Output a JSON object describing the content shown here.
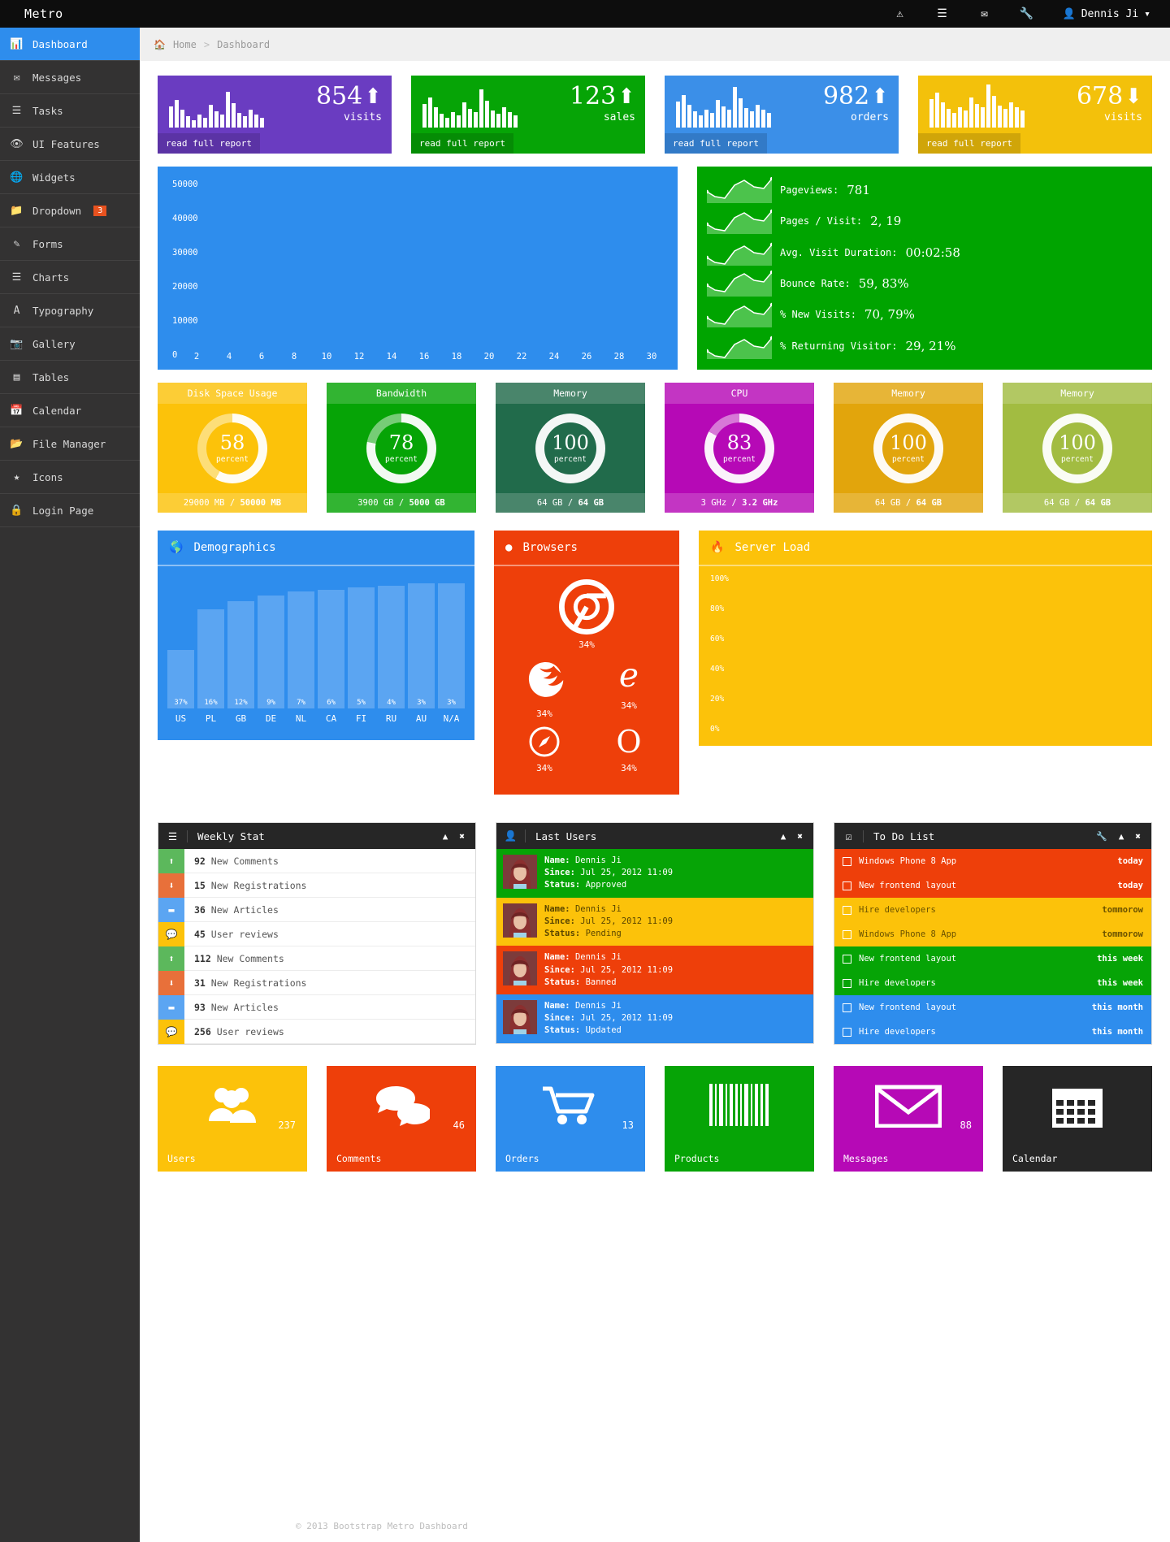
{
  "header": {
    "brand": "Metro",
    "icons": [
      "warning-icon",
      "list-icon",
      "envelope-icon",
      "wrench-icon"
    ],
    "user": "Dennis Ji"
  },
  "sidebar": {
    "items": [
      {
        "label": "Dashboard",
        "icon": "chart-icon",
        "active": true
      },
      {
        "label": "Messages",
        "icon": "envelope-icon"
      },
      {
        "label": "Tasks",
        "icon": "tasks-icon"
      },
      {
        "label": "UI Features",
        "icon": "eye-icon"
      },
      {
        "label": "Widgets",
        "icon": "globe-icon"
      },
      {
        "label": "Dropdown",
        "icon": "folder-icon",
        "badge": "3"
      },
      {
        "label": "Forms",
        "icon": "edit-icon"
      },
      {
        "label": "Charts",
        "icon": "bars-icon"
      },
      {
        "label": "Typography",
        "icon": "font-icon"
      },
      {
        "label": "Gallery",
        "icon": "image-icon"
      },
      {
        "label": "Tables",
        "icon": "table-icon"
      },
      {
        "label": "Calendar",
        "icon": "calendar-icon"
      },
      {
        "label": "File Manager",
        "icon": "folder-open-icon"
      },
      {
        "label": "Icons",
        "icon": "star-icon"
      },
      {
        "label": "Login Page",
        "icon": "lock-icon"
      }
    ]
  },
  "breadcrumb": {
    "home": "Home",
    "sep": ">",
    "current": "Dashboard"
  },
  "stat_tiles": [
    {
      "value": "854",
      "label": "visits",
      "dir": "up",
      "button": "read full report",
      "color": "#6a3cc1"
    },
    {
      "value": "123",
      "label": "sales",
      "dir": "up",
      "button": "read full report",
      "color": "#06a406"
    },
    {
      "value": "982",
      "label": "orders",
      "dir": "up",
      "button": "read full report",
      "color": "#3b8fe8"
    },
    {
      "value": "678",
      "label": "visits",
      "dir": "down",
      "button": "read full report",
      "color": "#f3c10b"
    }
  ],
  "chart_data": [
    {
      "type": "area",
      "title": "",
      "xlabel": "",
      "ylabel": "",
      "x": [
        2,
        4,
        6,
        8,
        10,
        12,
        14,
        16,
        18,
        20,
        22,
        24,
        26,
        28,
        30
      ],
      "yticks": [
        0,
        10000,
        20000,
        30000,
        40000,
        50000
      ],
      "ylim": [
        0,
        50000
      ],
      "values": [],
      "grid": false
    },
    {
      "type": "bar",
      "title": "Demographics",
      "categories": [
        "US",
        "PL",
        "GB",
        "DE",
        "NL",
        "CA",
        "FI",
        "RU",
        "AU",
        "N/A"
      ],
      "values": [
        37,
        16,
        12,
        9,
        7,
        6,
        5,
        4,
        3,
        3
      ],
      "datalabels": [
        "37%",
        "16%",
        "12%",
        "9%",
        "7%",
        "6%",
        "5%",
        "4%",
        "3%",
        "3%"
      ],
      "ylim": [
        0,
        100
      ],
      "xlabel": "",
      "ylabel": "",
      "grid": false
    },
    {
      "type": "bar",
      "title": "Server Load",
      "categories": [],
      "values": [],
      "yticks": [
        "0%",
        "20%",
        "40%",
        "60%",
        "80%",
        "100%"
      ],
      "ylim": [
        0,
        100
      ],
      "xlabel": "",
      "ylabel": "",
      "grid": false
    }
  ],
  "green_stats": [
    {
      "label": "Pageviews:",
      "value": "781"
    },
    {
      "label": "Pages / Visit:",
      "value": "2, 19"
    },
    {
      "label": "Avg. Visit Duration:",
      "value": "00:02:58"
    },
    {
      "label": "Bounce Rate:",
      "value": "59, 83%"
    },
    {
      "label": "% New Visits:",
      "value": "70, 79%"
    },
    {
      "label": "% Returning Visitor:",
      "value": "29, 21%"
    }
  ],
  "donuts": [
    {
      "title": "Disk Space Usage",
      "percent": "58",
      "unit": "percent",
      "used": "29000 MB",
      "sep": "/",
      "total": "50000 MB",
      "color": "#fcc20a",
      "arc": 58
    },
    {
      "title": "Bandwidth",
      "percent": "78",
      "unit": "percent",
      "used": "3900 GB",
      "sep": "/",
      "total": "5000 GB",
      "color": "#06a406",
      "arc": 78
    },
    {
      "title": "Memory",
      "percent": "100",
      "unit": "percent",
      "used": "64 GB",
      "sep": "/",
      "total": "64 GB",
      "color": "#216b4b",
      "arc": 100
    },
    {
      "title": "CPU",
      "percent": "83",
      "unit": "percent",
      "used": "3 GHz",
      "sep": "/",
      "total": "3.2 GHz",
      "color": "#b609b6",
      "arc": 83
    },
    {
      "title": "Memory",
      "percent": "100",
      "unit": "percent",
      "used": "64 GB",
      "sep": "/",
      "total": "64 GB",
      "color": "#e2a50c",
      "arc": 100
    },
    {
      "title": "Memory",
      "percent": "100",
      "unit": "percent",
      "used": "64 GB",
      "sep": "/",
      "total": "64 GB",
      "color": "#a2bc41",
      "arc": 100
    }
  ],
  "demographics": {
    "title": "Demographics",
    "icon": "globe-icon"
  },
  "browsers": {
    "title": "Browsers",
    "icon": "circle-icon",
    "items": [
      {
        "name": "chrome-icon",
        "pct": "34%"
      },
      {
        "name": "firefox-icon",
        "pct": "34%"
      },
      {
        "name": "ie-icon",
        "pct": "34%"
      },
      {
        "name": "safari-icon",
        "pct": "34%"
      },
      {
        "name": "opera-icon",
        "pct": "34%"
      }
    ]
  },
  "server_load": {
    "title": "Server Load",
    "icon": "fire-icon",
    "yticks": [
      "100%",
      "80%",
      "60%",
      "40%",
      "20%",
      "0%"
    ]
  },
  "weekly_stat": {
    "title": "Weekly Stat",
    "icon": "list-icon",
    "actions": [
      "collapse-icon",
      "close-icon"
    ],
    "rows": [
      {
        "icon": "arrow-up-icon",
        "color": "#5cb85c",
        "num": "92",
        "text": "New Comments"
      },
      {
        "icon": "arrow-down-icon",
        "color": "#e8703a",
        "num": "15",
        "text": "New Registrations"
      },
      {
        "icon": "minus-icon",
        "color": "#5ba5f2",
        "num": "36",
        "text": "New Articles"
      },
      {
        "icon": "comment-icon",
        "color": "#fcc20a",
        "num": "45",
        "text": "User reviews"
      },
      {
        "icon": "arrow-up-icon",
        "color": "#5cb85c",
        "num": "112",
        "text": "New Comments"
      },
      {
        "icon": "arrow-down-icon",
        "color": "#e8703a",
        "num": "31",
        "text": "New Registrations"
      },
      {
        "icon": "minus-icon",
        "color": "#5ba5f2",
        "num": "93",
        "text": "New Articles"
      },
      {
        "icon": "comment-icon",
        "color": "#fcc20a",
        "num": "256",
        "text": "User reviews"
      }
    ]
  },
  "last_users": {
    "title": "Last Users",
    "icon": "user-icon",
    "actions": [
      "collapse-icon",
      "close-icon"
    ],
    "labels": {
      "name": "Name:",
      "since": "Since:",
      "status": "Status:"
    },
    "rows": [
      {
        "name": "Dennis Ji",
        "since": "Jul 25, 2012 11:09",
        "status": "Approved",
        "color": "#06a406"
      },
      {
        "name": "Dennis Ji",
        "since": "Jul 25, 2012 11:09",
        "status": "Pending",
        "color": "#fcc20a"
      },
      {
        "name": "Dennis Ji",
        "since": "Jul 25, 2012 11:09",
        "status": "Banned",
        "color": "#ee3f0a"
      },
      {
        "name": "Dennis Ji",
        "since": "Jul 25, 2012 11:09",
        "status": "Updated",
        "color": "#2e8ded"
      }
    ]
  },
  "todo_list": {
    "title": "To Do List",
    "icon": "check-square-icon",
    "actions": [
      "wrench-icon",
      "collapse-icon",
      "close-icon"
    ],
    "rows": [
      {
        "text": "Windows Phone 8 App",
        "when": "today",
        "color": "#ee3f0a"
      },
      {
        "text": "New frontend layout",
        "when": "today",
        "color": "#ee3f0a"
      },
      {
        "text": "Hire developers",
        "when": "tommorow",
        "color": "#fcc20a"
      },
      {
        "text": "Windows Phone 8 App",
        "when": "tommorow",
        "color": "#fcc20a"
      },
      {
        "text": "New frontend layout",
        "when": "this week",
        "color": "#06a406"
      },
      {
        "text": "Hire developers",
        "when": "this week",
        "color": "#06a406"
      },
      {
        "text": "New frontend layout",
        "when": "this month",
        "color": "#2e8ded"
      },
      {
        "text": "Hire developers",
        "when": "this month",
        "color": "#2e8ded"
      }
    ]
  },
  "bottom_tiles": [
    {
      "label": "Users",
      "count": "237",
      "icon": "users-icon",
      "color": "#fcc20a"
    },
    {
      "label": "Comments",
      "count": "46",
      "icon": "comments-icon",
      "color": "#ee3f0a"
    },
    {
      "label": "Orders",
      "count": "13",
      "icon": "cart-icon",
      "color": "#2e8ded"
    },
    {
      "label": "Products",
      "count": "",
      "icon": "barcode-icon",
      "color": "#06a406"
    },
    {
      "label": "Messages",
      "count": "88",
      "icon": "envelope-icon",
      "color": "#b609b6"
    },
    {
      "label": "Calendar",
      "count": "",
      "icon": "calendar-icon",
      "color": "#262626"
    }
  ],
  "footer": {
    "text": "© 2013  Bootstrap Metro Dashboard"
  }
}
